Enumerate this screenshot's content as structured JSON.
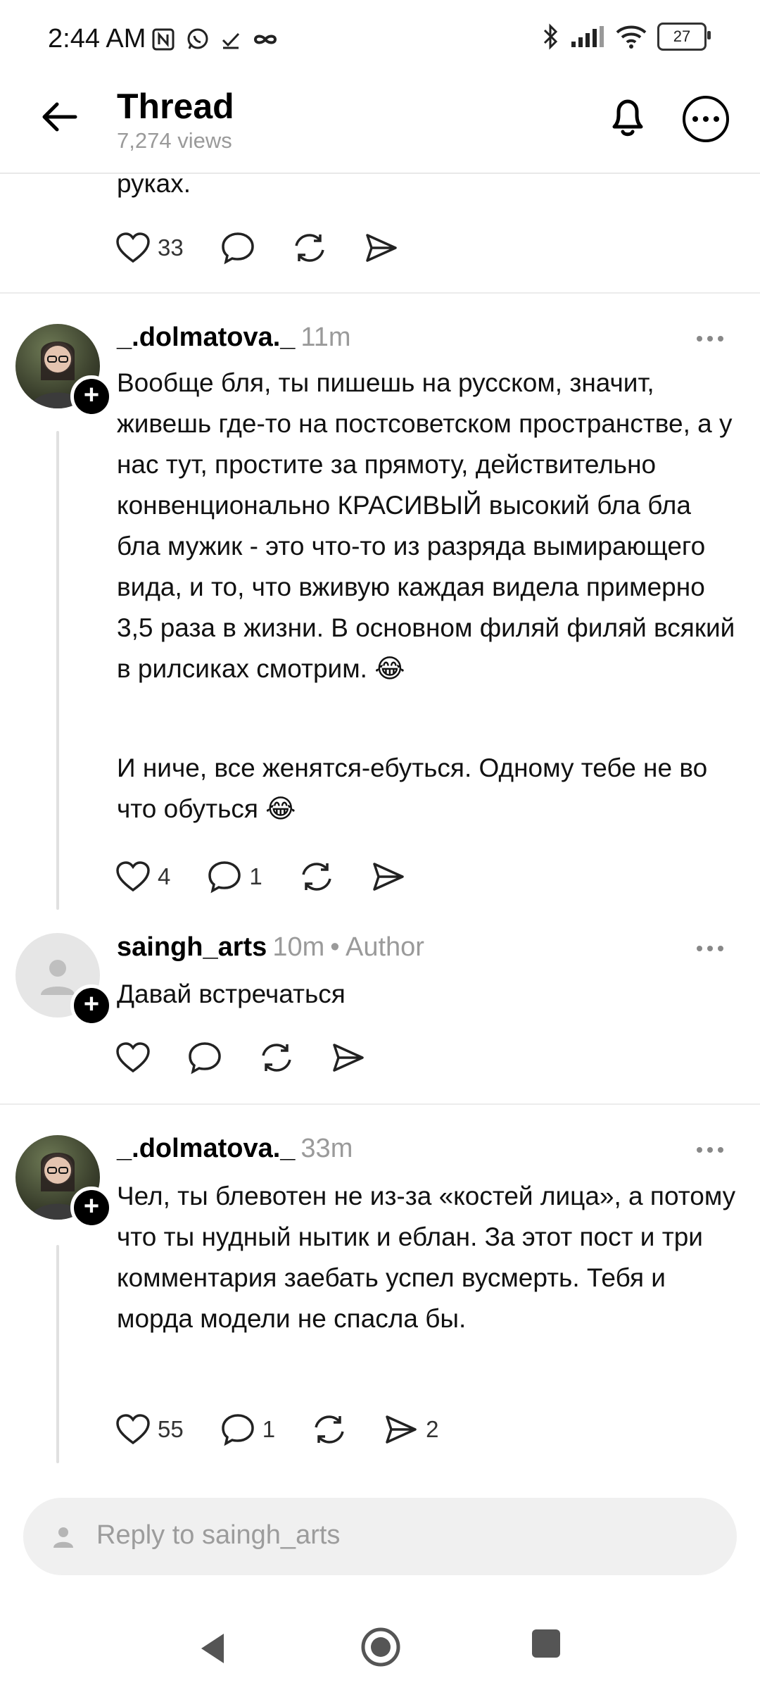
{
  "status_bar": {
    "time": "2:44 AM",
    "battery": "27"
  },
  "header": {
    "title": "Thread",
    "views": "7,274 views"
  },
  "top_post": {
    "text_tail": "руках.",
    "likes": "33"
  },
  "comments": [
    {
      "username": "_.dolmatova._",
      "time": "11m",
      "paragraphs": [
        "Вообще бля, ты пишешь на русском, значит, живешь где-то на постсоветском пространстве, а у нас тут, простите за прямоту, действительно конвенционально КРАСИВЫЙ высокий бла бла бла мужик - это что-то из разряда вымирающего вида, и то, что вживую каждая видела примерно 3,5 раза в жизни. В основном филяй филяй всякий в рилсиках смотрим. 😂",
        "И ниче, все женятся-ебуться. Одному тебе не во что обуться 😂"
      ],
      "likes": "4",
      "replies": "1"
    },
    {
      "username": "saingh_arts",
      "time": "10m",
      "tag": "• Author",
      "text": "Давай встречаться"
    },
    {
      "username": "_.dolmatova._",
      "time": "33m",
      "text": "Чел, ты блевотен не из-за «костей лица», а потому что ты нудный нытик и еблан. За этот пост и три комментария заебать успел вусмерть. Тебя и морда модели не спасла бы.",
      "likes": "55",
      "replies": "1",
      "shares": "2"
    }
  ],
  "reply_bar": {
    "placeholder": "Reply to saingh_arts"
  }
}
